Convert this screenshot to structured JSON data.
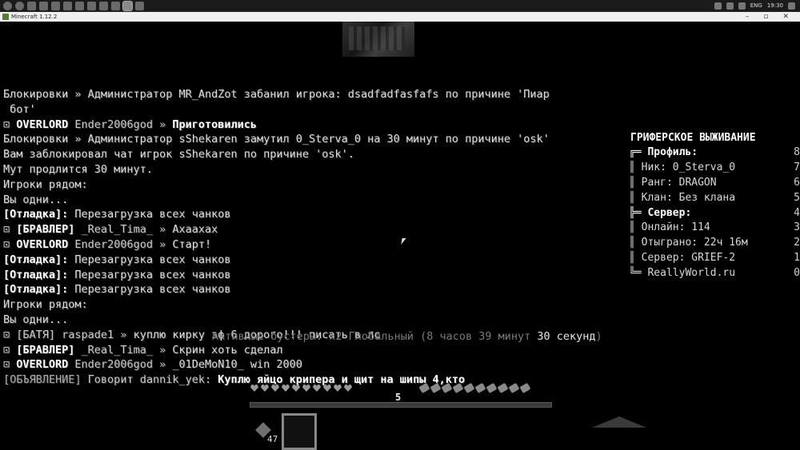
{
  "taskbar": {
    "icons": [
      "windows-icon",
      "cortana-icon",
      "explorer-icon",
      "store-icon",
      "mail-icon",
      "steam-icon",
      "chrome-icon",
      "yandex-icon",
      "discord-icon",
      "app-icon",
      "minecraft-icon",
      "minecraft-icon-2"
    ],
    "tray": {
      "language": "ENG",
      "time": "19:30"
    }
  },
  "window": {
    "title": "Minecraft 1.12.2",
    "minimize": "–",
    "maximize": "▫",
    "close": "✕"
  },
  "chat": [
    {
      "segments": [
        {
          "t": "Блокировки » Администратор MR_AndZot забанил игрока: dsadfadfasfafs по причине 'Пиар",
          "s": "n"
        }
      ]
    },
    {
      "segments": [
        {
          "t": " бот'",
          "s": "n"
        }
      ]
    },
    {
      "segments": [
        {
          "t": "⊡ ",
          "s": "g"
        },
        {
          "t": "OVERLORD",
          "s": "b"
        },
        {
          "t": " Ender2006god » ",
          "s": "g"
        },
        {
          "t": "Приготовились",
          "s": "b"
        }
      ]
    },
    {
      "segments": [
        {
          "t": "Блокировки » Администратор sShekaren замутил 0_Sterva_0 на 30 минут по причине 'osk'",
          "s": "n"
        }
      ]
    },
    {
      "segments": [
        {
          "t": "Вам заблокировал чат игрок sShekaren по причине 'osk'.",
          "s": "n"
        }
      ]
    },
    {
      "segments": [
        {
          "t": "Мут продлится 30 минут.",
          "s": "n"
        }
      ]
    },
    {
      "segments": [
        {
          "t": "Игроки рядом:",
          "s": "n"
        }
      ]
    },
    {
      "segments": [
        {
          "t": "Вы одни...",
          "s": "n"
        }
      ]
    },
    {
      "segments": [
        {
          "t": "[Отладка]:",
          "s": "b"
        },
        {
          "t": " Перезагрузка всех чанков",
          "s": "n"
        }
      ]
    },
    {
      "segments": [
        {
          "t": "⊡ ",
          "s": "g"
        },
        {
          "t": "[БРАВЛЕР]",
          "s": "b"
        },
        {
          "t": " _Real_Tima_ » ",
          "s": "g"
        },
        {
          "t": "Ахаахах",
          "s": "n"
        }
      ]
    },
    {
      "segments": [
        {
          "t": "⊡ ",
          "s": "g"
        },
        {
          "t": "OVERLORD",
          "s": "b"
        },
        {
          "t": " Ender2006god » ",
          "s": "g"
        },
        {
          "t": "Старт!",
          "s": "n"
        }
      ]
    },
    {
      "segments": [
        {
          "t": "[Отладка]:",
          "s": "b"
        },
        {
          "t": " Перезагрузка всех чанков",
          "s": "n"
        }
      ]
    },
    {
      "segments": [
        {
          "t": "[Отладка]:",
          "s": "b"
        },
        {
          "t": " Перезагрузка всех чанков",
          "s": "n"
        }
      ]
    },
    {
      "segments": [
        {
          "t": "[Отладка]:",
          "s": "b"
        },
        {
          "t": " Перезагрузка всех чанков",
          "s": "n"
        }
      ]
    },
    {
      "segments": [
        {
          "t": "Игроки рядом:",
          "s": "n"
        }
      ]
    },
    {
      "segments": [
        {
          "t": "Вы одни...",
          "s": "n"
        }
      ]
    },
    {
      "segments": [
        {
          "t": "⊡ [БАТЯ] raspade1 » ",
          "s": "g"
        },
        {
          "t": "куплю кирку эф 6 дорого!!! писать в лс",
          "s": "n"
        }
      ]
    },
    {
      "segments": [
        {
          "t": "⊡ ",
          "s": "g"
        },
        {
          "t": "[БРАВЛЕР]",
          "s": "b"
        },
        {
          "t": " _Real_Tima_ » ",
          "s": "g"
        },
        {
          "t": "Скрин хоть сделал",
          "s": "n"
        }
      ]
    },
    {
      "segments": [
        {
          "t": "⊡ ",
          "s": "g"
        },
        {
          "t": "OVERLORD",
          "s": "b"
        },
        {
          "t": " Ender2006god » ",
          "s": "g"
        },
        {
          "t": "_01DeMoN10_ win 2000",
          "s": "n"
        }
      ]
    },
    {
      "segments": [
        {
          "t": "[ОБЪЯВЛЕНИЕ]",
          "s": "d"
        },
        {
          "t": " Говорит dannik_yek: ",
          "s": "g"
        },
        {
          "t": "Куплю яйцо крипера и щит на шипы 4,кто",
          "s": "b"
        }
      ]
    }
  ],
  "boosters": {
    "prefix": "Активные бустеры: х2 Глобальный (8 часов 39 минут ",
    "highlight": "30 секунд",
    "suffix": ")"
  },
  "scoreboard": {
    "title": "ГРИФЕРСКОЕ ВЫЖИВАНИЕ",
    "rows": [
      {
        "label": "╔═ Профиль:",
        "score": "8",
        "header": true
      },
      {
        "label": "║ Ник: 0_Sterva_0",
        "score": "7",
        "header": false
      },
      {
        "label": "║ Ранг: DRAGON",
        "score": "6",
        "header": false
      },
      {
        "label": "║ Клан: Без клана",
        "score": "5",
        "header": false
      },
      {
        "label": "╠═ Сервер:",
        "score": "4",
        "header": true
      },
      {
        "label": "║ Онлайн: 114",
        "score": "3",
        "header": false
      },
      {
        "label": "║ Отыграно: 22ч 16м",
        "score": "2",
        "header": false
      },
      {
        "label": "║ Сервер: GRIEF-2",
        "score": "1",
        "header": false
      },
      {
        "label": "╚═ ReallyWorld.ru",
        "score": "0",
        "header": false
      }
    ]
  },
  "hud": {
    "health_fraction": 1.0,
    "hunger_fraction": 1.0,
    "xp_level": "5",
    "offhand_count": "47",
    "hearts": 10,
    "hunger_icons": 10
  }
}
